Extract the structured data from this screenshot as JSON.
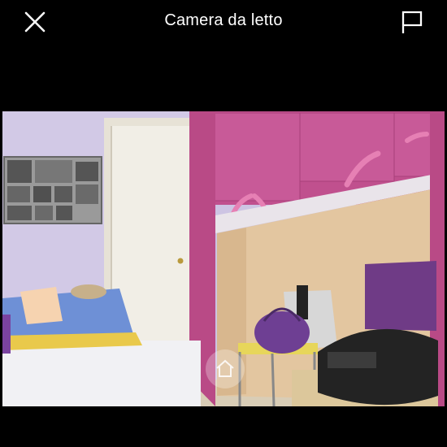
{
  "header": {
    "title": "Camera da letto",
    "close_icon": "close-icon",
    "report_icon": "flag-icon"
  },
  "photo": {
    "subject": "bedroom",
    "watermark_icon": "home-icon"
  },
  "colors": {
    "background": "#000000",
    "header_text": "#ffffff",
    "accent_furniture": "#c0508e"
  }
}
